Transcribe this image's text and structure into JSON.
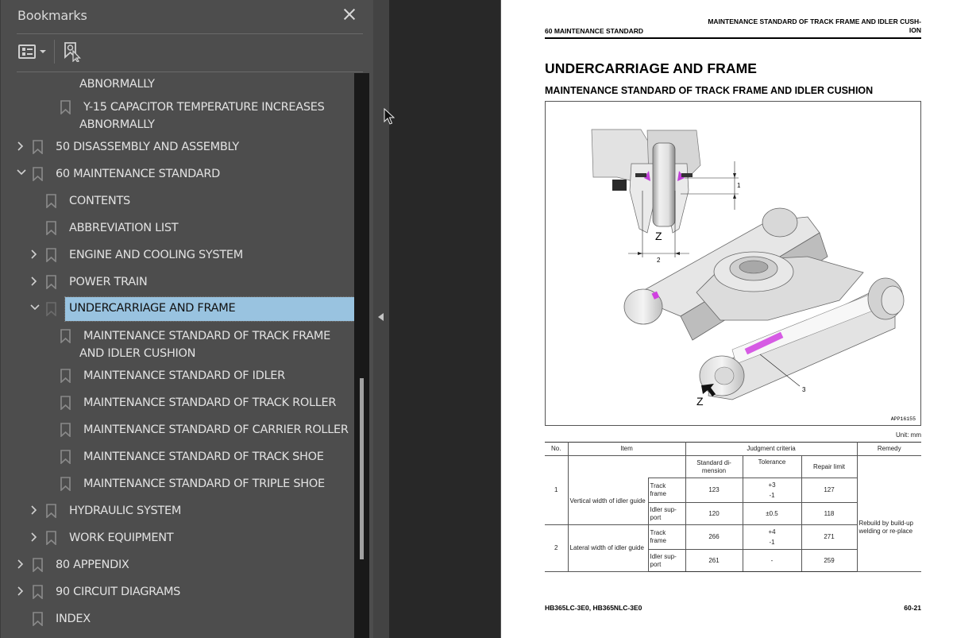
{
  "sidebar": {
    "title": "Bookmarks",
    "close_icon": "close-icon",
    "toolbar": {
      "options_icon": "list-options-icon",
      "find_icon": "find-current-bookmark-icon"
    },
    "scroll_position": 0.83,
    "items": [
      {
        "label": "ABNORMALLY",
        "level": 2,
        "continuation": true,
        "expander": "none",
        "selected": false
      },
      {
        "label": "Y-15 CAPACITOR TEMPERATURE INCREASES",
        "label2": "ABNORMALLY",
        "level": 2,
        "expander": "none",
        "selected": false
      },
      {
        "label": "50 DISASSEMBLY AND ASSEMBLY",
        "level": 0,
        "expander": "collapsed",
        "selected": false
      },
      {
        "label": "60 MAINTENANCE STANDARD",
        "level": 0,
        "expander": "expanded",
        "selected": false
      },
      {
        "label": "CONTENTS",
        "level": 1,
        "expander": "none",
        "selected": false
      },
      {
        "label": "ABBREVIATION LIST",
        "level": 1,
        "expander": "none",
        "selected": false
      },
      {
        "label": "ENGINE AND COOLING SYSTEM",
        "level": 1,
        "expander": "collapsed",
        "selected": false
      },
      {
        "label": "POWER TRAIN",
        "level": 1,
        "expander": "collapsed",
        "selected": false
      },
      {
        "label": "UNDERCARRIAGE AND FRAME",
        "level": 1,
        "expander": "expanded",
        "selected": true
      },
      {
        "label": "MAINTENANCE STANDARD OF TRACK FRAME",
        "label2": "AND IDLER CUSHION",
        "level": 2,
        "expander": "none",
        "selected": false
      },
      {
        "label": "MAINTENANCE STANDARD OF IDLER",
        "level": 2,
        "expander": "none",
        "selected": false
      },
      {
        "label": "MAINTENANCE STANDARD OF TRACK ROLLER",
        "level": 2,
        "expander": "none",
        "selected": false
      },
      {
        "label": "MAINTENANCE STANDARD OF CARRIER ROLLER",
        "level": 2,
        "expander": "none",
        "selected": false
      },
      {
        "label": "MAINTENANCE STANDARD OF TRACK SHOE",
        "level": 2,
        "expander": "none",
        "selected": false
      },
      {
        "label": "MAINTENANCE STANDARD OF TRIPLE SHOE",
        "level": 2,
        "expander": "none",
        "selected": false
      },
      {
        "label": "HYDRAULIC SYSTEM",
        "level": 1,
        "expander": "collapsed",
        "selected": false
      },
      {
        "label": "WORK EQUIPMENT",
        "level": 1,
        "expander": "collapsed",
        "selected": false
      },
      {
        "label": "80 APPENDIX",
        "level": 0,
        "expander": "collapsed",
        "selected": false
      },
      {
        "label": "90 CIRCUIT DIAGRAMS",
        "level": 0,
        "expander": "collapsed",
        "selected": false
      },
      {
        "label": "INDEX",
        "level": 0,
        "expander": "none",
        "selected": false
      }
    ]
  },
  "splitter": {
    "collapse_icon": "triangle-left-icon"
  },
  "document": {
    "header_left": "60 MAINTENANCE STANDARD",
    "header_right_line1": "MAINTENANCE STANDARD OF TRACK FRAME AND IDLER CUSH-",
    "header_right_line2": "ION",
    "heading": "UNDERCARRIAGE AND FRAME",
    "subheading": "MAINTENANCE STANDARD OF TRACK FRAME AND IDLER CUSHION",
    "figure": {
      "id": "APP16155",
      "callouts": [
        "1",
        "2",
        "3"
      ],
      "view_label": "Z",
      "highlight_color": "#d040e0"
    },
    "unit": "Unit: mm",
    "table": {
      "headers": {
        "no": "No.",
        "item": "Item",
        "judgment": "Judgment criteria",
        "remedy": "Remedy",
        "standard": "Standard di-\nmension",
        "tolerance": "Tolerance",
        "repair": "Repair limit"
      },
      "rows": [
        {
          "no": "1",
          "item": "Vertical width of idler guide",
          "sub": [
            {
              "part": "Track frame",
              "standard": "123",
              "tol_plus": "+3",
              "tol_minus": "-1",
              "repair": "127"
            },
            {
              "part": "Idler sup-port",
              "standard": "120",
              "tolerance": "±0.5",
              "repair": "118"
            }
          ]
        },
        {
          "no": "2",
          "item": "Lateral width of idler guide",
          "sub": [
            {
              "part": "Track frame",
              "standard": "266",
              "tol_plus": "+4",
              "tol_minus": "-1",
              "repair": "271"
            },
            {
              "part": "Idler sup-port",
              "standard": "261",
              "tolerance": "-",
              "repair": "259"
            }
          ]
        }
      ],
      "remedy": "Rebuild by build-up welding or re-place"
    },
    "footer_left": "HB365LC-3E0, HB365NLC-3E0",
    "footer_right": "60-21"
  }
}
